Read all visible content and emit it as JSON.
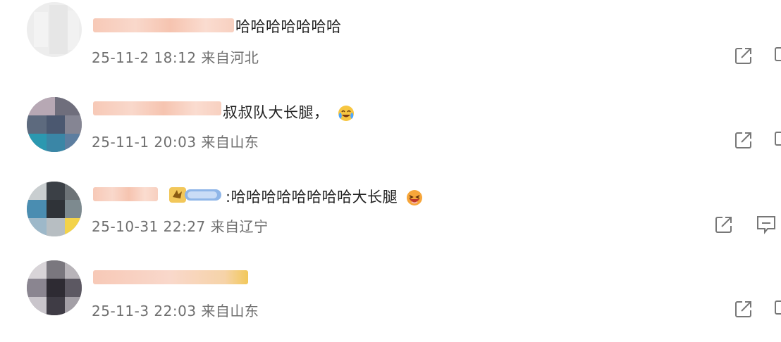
{
  "comments": [
    {
      "content": "哈哈哈哈哈哈哈",
      "date": "25-11-2 18:12",
      "location": "来自河北",
      "actions": [
        "share-icon",
        "reply-icon"
      ]
    },
    {
      "content": "叔叔队大长腿，",
      "date": "25-11-1 20:03",
      "location": "来自山东",
      "emoji": "crying-laughing-emoji",
      "actions": [
        "share-icon",
        "reply-icon"
      ]
    },
    {
      "content": ":哈哈哈哈哈哈哈哈大长腿",
      "date": "25-10-31 22:27",
      "location": "来自辽宁",
      "emoji": "laughing-emoji",
      "actions": [
        "share-icon",
        "reply-icon"
      ]
    },
    {
      "date": "25-11-3 22:03",
      "location": "来自山东",
      "actions": [
        "share-icon",
        "reply-icon"
      ]
    }
  ],
  "colors": {
    "meta_text": "#6f6f6f",
    "content_text": "#222222",
    "icon_stroke": "#777777",
    "blurred_name": "#f7c9b7"
  }
}
